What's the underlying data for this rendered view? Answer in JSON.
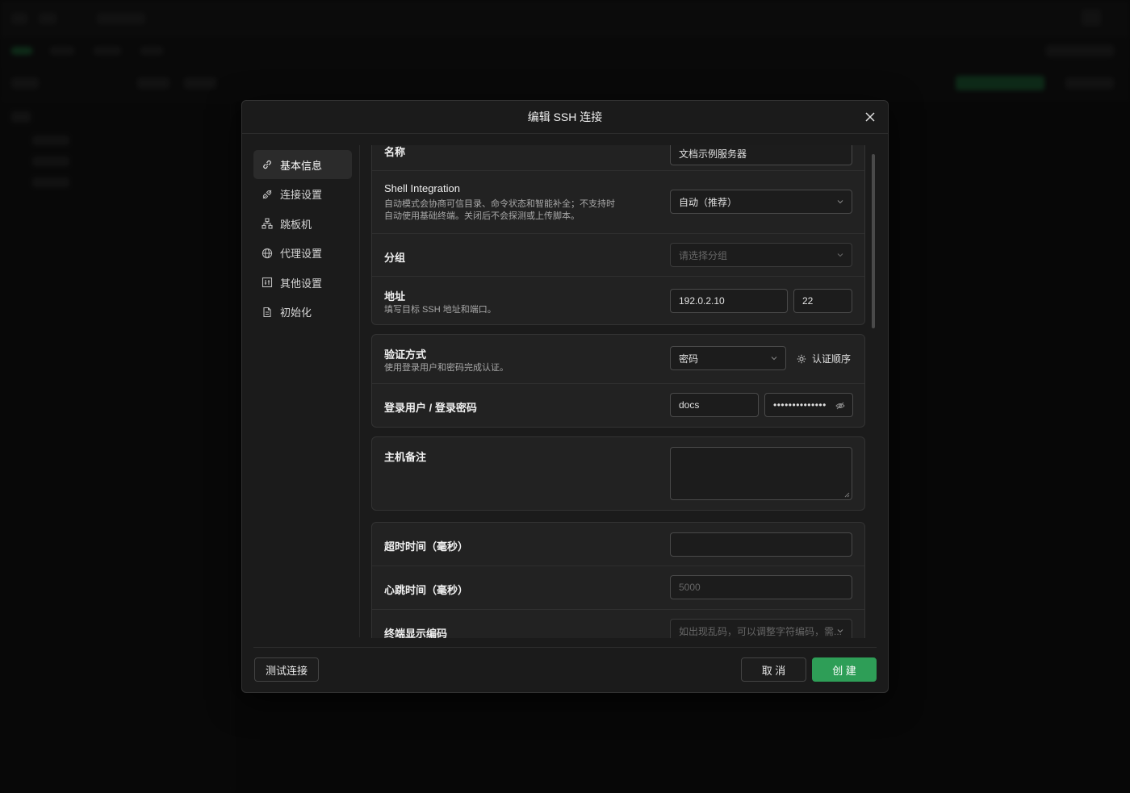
{
  "modal": {
    "title": "编辑 SSH 连接"
  },
  "nav": {
    "items": [
      {
        "label": "基本信息",
        "icon": "link-icon"
      },
      {
        "label": "连接设置",
        "icon": "plug-icon"
      },
      {
        "label": "跳板机",
        "icon": "network-icon"
      },
      {
        "label": "代理设置",
        "icon": "globe-icon"
      },
      {
        "label": "其他设置",
        "icon": "sliders-icon"
      },
      {
        "label": "初始化",
        "icon": "file-icon"
      }
    ]
  },
  "form": {
    "name_label": "名称",
    "name_value": "文档示例服务器",
    "shell_label": "Shell Integration",
    "shell_desc_1": "自动模式会协商可信目录、命令状态和智能补全；不支持时",
    "shell_desc_2": "自动使用基础终端。关闭后不会探测或上传脚本。",
    "shell_value": "自动（推荐）",
    "group_label": "分组",
    "group_placeholder": "请选择分组",
    "address_label": "地址",
    "address_desc": "填写目标 SSH 地址和端口。",
    "host_value": "192.0.2.10",
    "port_value": "22",
    "auth_label": "验证方式",
    "auth_desc": "使用登录用户和密码完成认证。",
    "auth_value": "密码",
    "auth_order_label": "认证顺序",
    "cred_label": "登录用户 / 登录密码",
    "user_value": "docs",
    "password_value": "••••••••••••••",
    "note_label": "主机备注",
    "timeout_label": "超时时间（毫秒）",
    "timeout_value": "",
    "heartbeat_label": "心跳时间（毫秒）",
    "heartbeat_placeholder": "5000",
    "encoding_label": "终端显示编码",
    "encoding_placeholder": "如出现乱码，可以调整字符编码，需..."
  },
  "footer": {
    "test_label": "测试连接",
    "cancel_label": "取 消",
    "create_label": "创 建"
  },
  "colors": {
    "accent": "#2e9e57",
    "background": "#1b1b1b",
    "card": "#222222"
  }
}
